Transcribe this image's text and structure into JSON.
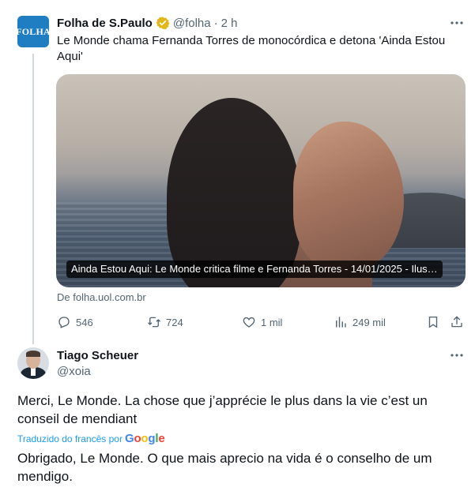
{
  "tweet_main": {
    "avatar_text": "FOLHA",
    "name": "Folha de S.Paulo",
    "handle": "@folha",
    "separator": "·",
    "time": "2 h",
    "text": "Le Monde chama Fernanda Torres de monocórdica e detona 'Ainda Estou Aqui'",
    "card_caption": "Ainda Estou Aqui: Le Monde critica filme e Fernanda Torres - 14/01/2025 - Ilus…",
    "source": "De folha.uol.com.br",
    "stats": {
      "replies": "546",
      "retweets": "724",
      "likes": "1 mil",
      "views": "249 mil"
    }
  },
  "reply": {
    "name": "Tiago Scheuer",
    "handle": "@xoia",
    "original_text": "Merci, Le Monde. La chose que j’apprécie le plus dans la vie c’est un conseil de mendiant",
    "translated_label": "Traduzido do francês por",
    "google": [
      "G",
      "o",
      "o",
      "g",
      "l",
      "e"
    ],
    "translated_text": "Obrigado, Le Monde. O que mais aprecio na vida é o conselho de um mendigo."
  },
  "icons": {
    "more": "more-dots-icon",
    "verified": "verified-badge-icon",
    "reply": "reply-icon",
    "retweet": "retweet-icon",
    "like": "heart-icon",
    "views": "views-icon",
    "bookmark": "bookmark-icon",
    "share": "share-icon"
  },
  "colors": {
    "text": "#0f1419",
    "muted": "#536471",
    "accent": "#1d9bf0",
    "verified_gold": "#e2b719",
    "folha_blue": "#1f7ec1"
  }
}
